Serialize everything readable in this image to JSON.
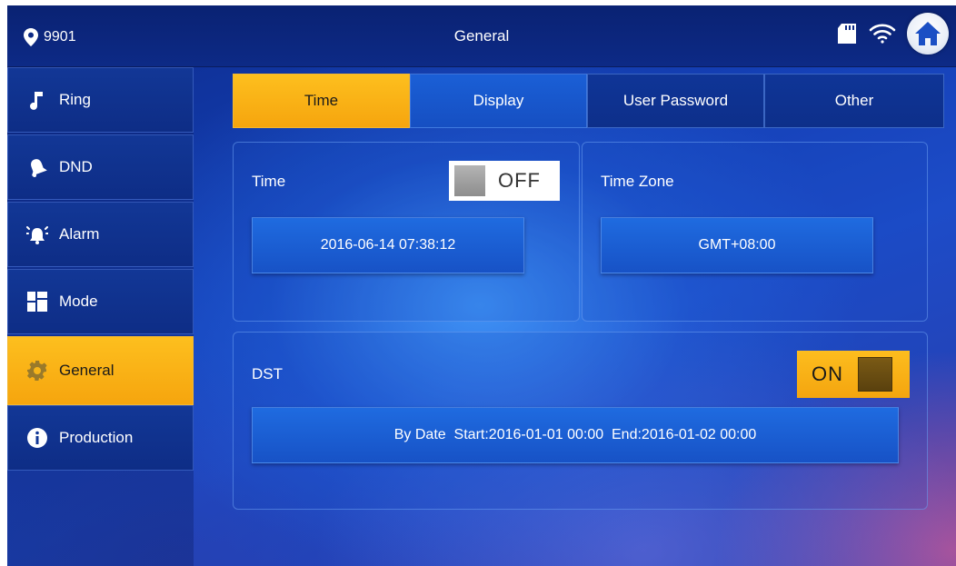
{
  "header": {
    "room_number": "9901",
    "title": "General",
    "icons": {
      "location": "location-pin-icon",
      "sd_card": "sd-card-icon",
      "wifi": "wifi-icon",
      "home": "home-icon"
    }
  },
  "sidebar": {
    "items": [
      {
        "label": "Ring",
        "icon": "music-note-icon",
        "active": false
      },
      {
        "label": "DND",
        "icon": "bell-icon",
        "active": false
      },
      {
        "label": "Alarm",
        "icon": "alarm-icon",
        "active": false
      },
      {
        "label": "Mode",
        "icon": "mode-grid-icon",
        "active": false
      },
      {
        "label": "General",
        "icon": "gear-icon",
        "active": true
      },
      {
        "label": "Production",
        "icon": "info-icon",
        "active": false
      }
    ]
  },
  "tabs": [
    {
      "label": "Time",
      "active": true
    },
    {
      "label": "Display",
      "active": false
    },
    {
      "label": "User Password",
      "active": false
    },
    {
      "label": "Other",
      "active": false
    }
  ],
  "time_panel": {
    "label": "Time",
    "toggle_state": "OFF",
    "value": "2016-06-14 07:38:12"
  },
  "timezone_panel": {
    "label": "Time Zone",
    "value": "GMT+08:00"
  },
  "dst_panel": {
    "label": "DST",
    "toggle_state": "ON",
    "value": "By Date  Start:2016-01-01 00:00  End:2016-01-02 00:00"
  },
  "colors": {
    "accent": "#fdbf1e",
    "background": "#1541b8",
    "bar": "#0a2273"
  }
}
